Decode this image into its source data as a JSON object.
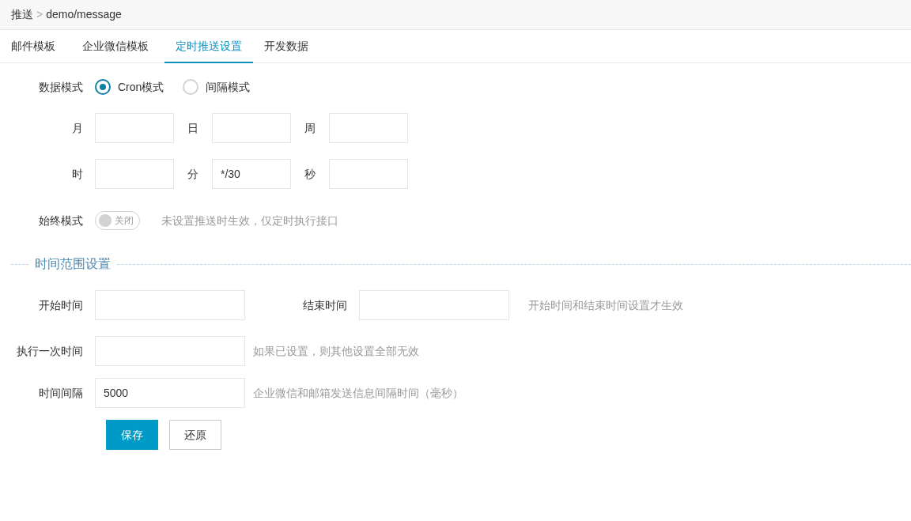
{
  "breadcrumb": {
    "root": "推送",
    "separator": ">",
    "path": "demo/message"
  },
  "tabs": [
    {
      "label": "邮件模板",
      "selected": false
    },
    {
      "label": "企业微信模板",
      "selected": false
    },
    {
      "label": "定时推送设置",
      "selected": true
    },
    {
      "label": "开发数据",
      "selected": false
    }
  ],
  "data_mode": {
    "label": "数据模式",
    "options": [
      {
        "label": "Cron模式",
        "selected": true
      },
      {
        "label": "间隔模式",
        "selected": false
      }
    ]
  },
  "cron_rows": [
    [
      {
        "label": "月"
      },
      {
        "label": "日"
      },
      {
        "label": "周"
      }
    ],
    [
      {
        "label": "时"
      },
      {
        "label": "分",
        "value": "*/30"
      },
      {
        "label": "秒"
      }
    ]
  ],
  "always_mode": {
    "label": "始终模式",
    "on": false,
    "switch_text": "关闭",
    "hint": "未设置推送时生效，仅定时执行接口"
  },
  "time_range": {
    "legend": "时间范围设置",
    "start": {
      "label": "开始时间"
    },
    "end": {
      "label": "结束时间"
    },
    "range_hint": "开始时间和结束时间设置才生效",
    "run_once": {
      "label": "执行一次时间",
      "hint": "如果已设置，则其他设置全部无效"
    },
    "interval": {
      "label": "时间间隔",
      "value": "5000",
      "hint": "企业微信和邮箱发送信息间隔时间（毫秒）"
    }
  },
  "buttons": [
    {
      "label": "保存",
      "kind": "primary"
    },
    {
      "label": "还原",
      "kind": "default"
    }
  ]
}
